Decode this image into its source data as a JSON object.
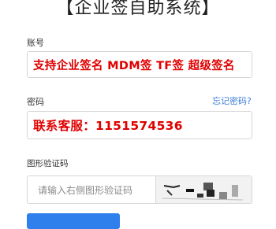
{
  "title": "【企业签自助系统】",
  "account": {
    "label": "账号",
    "value": "支持企业签名 MDM签 TF签 超级签名"
  },
  "password": {
    "label": "密码",
    "forgot_link": "忘记密码?",
    "value": "联系客服：1151574536"
  },
  "captcha": {
    "label": "图形验证码",
    "placeholder": "请输入右侧图形验证码"
  },
  "colors": {
    "accent": "#2f80ed",
    "link": "#3a7dd8",
    "highlight_text": "#e00000"
  }
}
